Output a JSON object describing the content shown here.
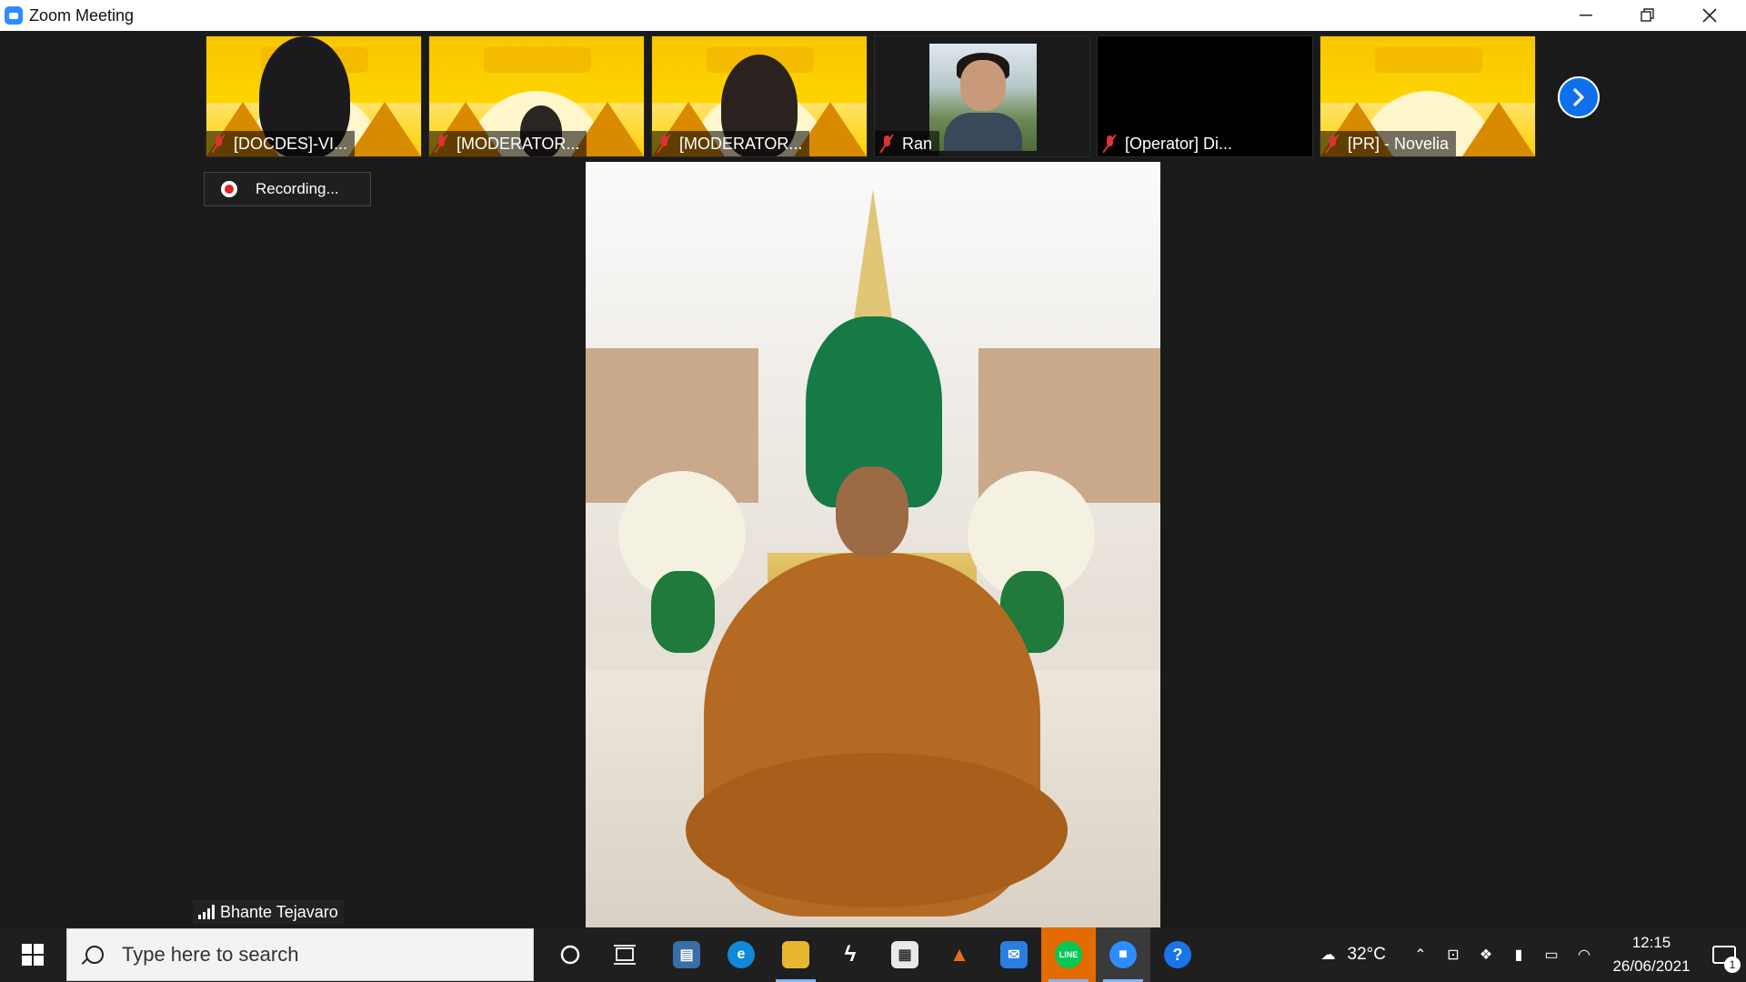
{
  "window": {
    "title": "Zoom Meeting",
    "controls": {
      "minimize": "—",
      "restore": "❐",
      "close": "✕"
    }
  },
  "participants": [
    {
      "name": "[DOCDES]-VI...",
      "muted": true,
      "background": "yellow-banner"
    },
    {
      "name": "[MODERATOR...",
      "muted": true,
      "background": "yellow-banner"
    },
    {
      "name": "[MODERATOR...",
      "muted": true,
      "background": "yellow-banner"
    },
    {
      "name": "Ran",
      "muted": true,
      "background": "photo"
    },
    {
      "name": "[Operator] Di...",
      "muted": true,
      "background": "black"
    },
    {
      "name": "[PR] - Novelia",
      "muted": true,
      "background": "yellow-banner"
    }
  ],
  "next_page_icon": "chevron-right-icon",
  "recording": {
    "label": "Recording..."
  },
  "active_speaker": {
    "name": "Bhante Tejavaro"
  },
  "taskbar": {
    "search_placeholder": "Type here to search",
    "apps": [
      {
        "name": "cortana",
        "glyph": "○"
      },
      {
        "name": "task-view",
        "glyph": "⧉"
      },
      {
        "name": "network-app",
        "glyph": "▤"
      },
      {
        "name": "edge",
        "glyph": "e"
      },
      {
        "name": "file-explorer",
        "glyph": "▬"
      },
      {
        "name": "app-bolt",
        "glyph": "ϟ"
      },
      {
        "name": "store",
        "glyph": "▦"
      },
      {
        "name": "matlab",
        "glyph": "▲"
      },
      {
        "name": "mail",
        "glyph": "✉"
      },
      {
        "name": "line",
        "glyph": "LINE"
      },
      {
        "name": "zoom",
        "glyph": "■"
      },
      {
        "name": "help",
        "glyph": "?"
      }
    ],
    "weather": {
      "temp": "32°C"
    },
    "clock": {
      "time": "12:15",
      "date": "26/06/2021"
    },
    "notifications": {
      "count": "1"
    }
  },
  "colors": {
    "accent": "#0e71eb",
    "taskbar": "#1f1f1f",
    "stage": "#1a1a1a"
  }
}
